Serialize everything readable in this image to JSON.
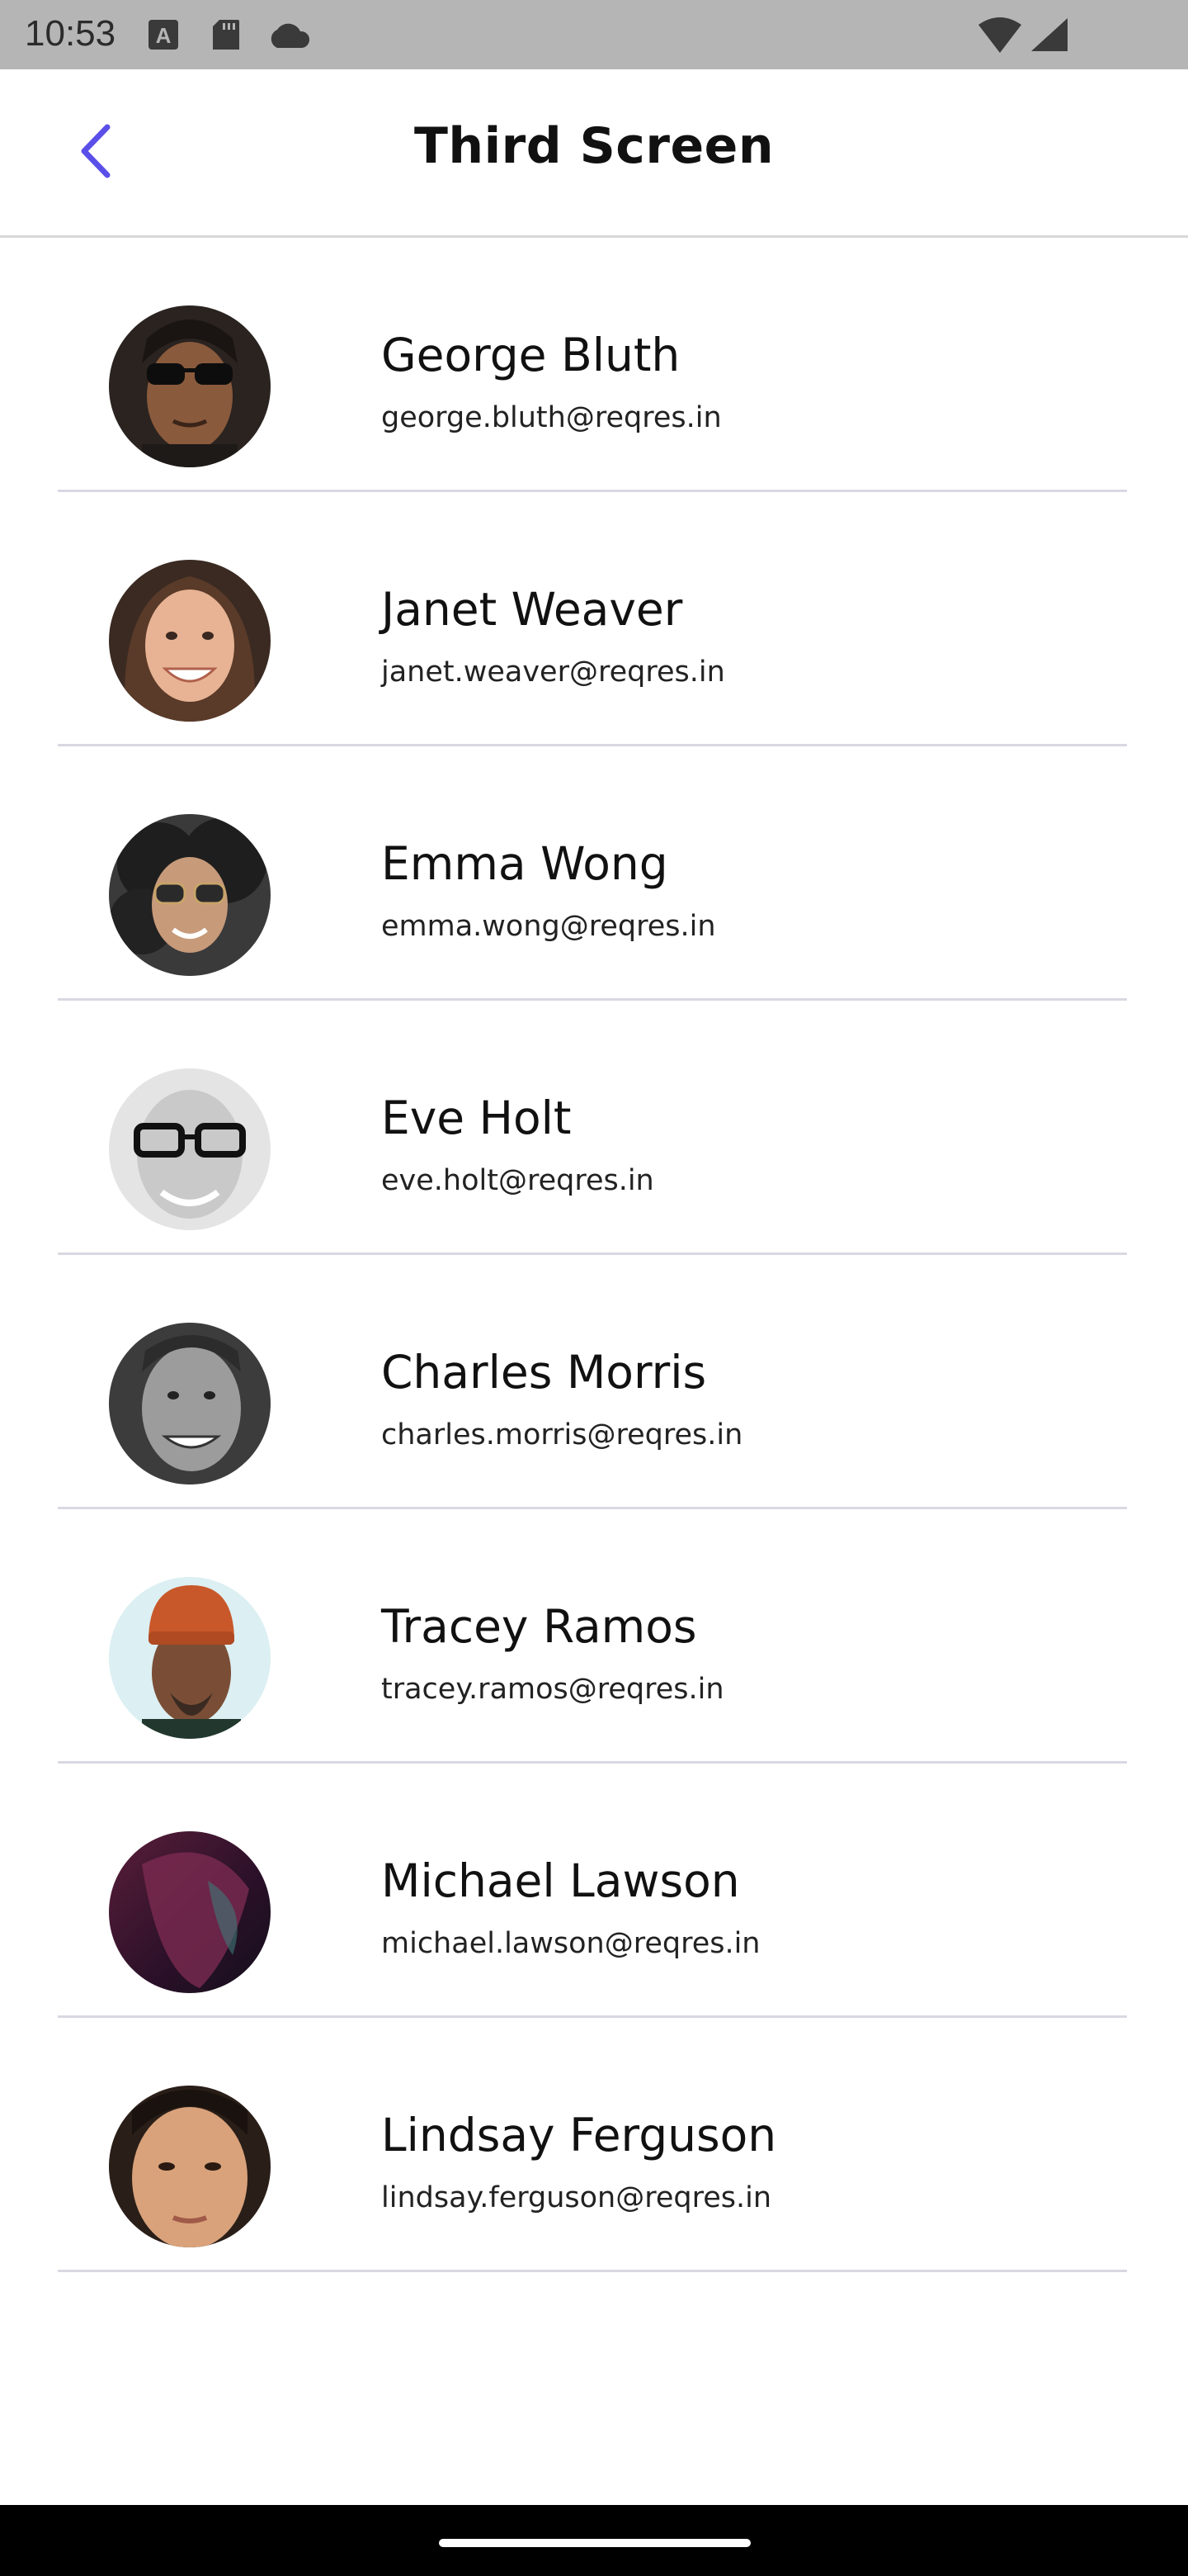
{
  "status_bar": {
    "time": "10:53",
    "icons": [
      "a-box-icon",
      "sd-card-icon",
      "cloud-icon",
      "wifi-icon",
      "cell-signal-icon"
    ]
  },
  "app_bar": {
    "back_icon": "chevron-left-icon",
    "title": "Third Screen",
    "accent_color": "#5b4fe9"
  },
  "users": [
    {
      "name": "George Bluth",
      "email": "george.bluth@reqres.in"
    },
    {
      "name": "Janet Weaver",
      "email": "janet.weaver@reqres.in"
    },
    {
      "name": "Emma Wong",
      "email": "emma.wong@reqres.in"
    },
    {
      "name": "Eve Holt",
      "email": "eve.holt@reqres.in"
    },
    {
      "name": "Charles Morris",
      "email": "charles.morris@reqres.in"
    },
    {
      "name": "Tracey Ramos",
      "email": "tracey.ramos@reqres.in"
    },
    {
      "name": "Michael Lawson",
      "email": "michael.lawson@reqres.in"
    },
    {
      "name": "Lindsay Ferguson",
      "email": "lindsay.ferguson@reqres.in"
    }
  ]
}
